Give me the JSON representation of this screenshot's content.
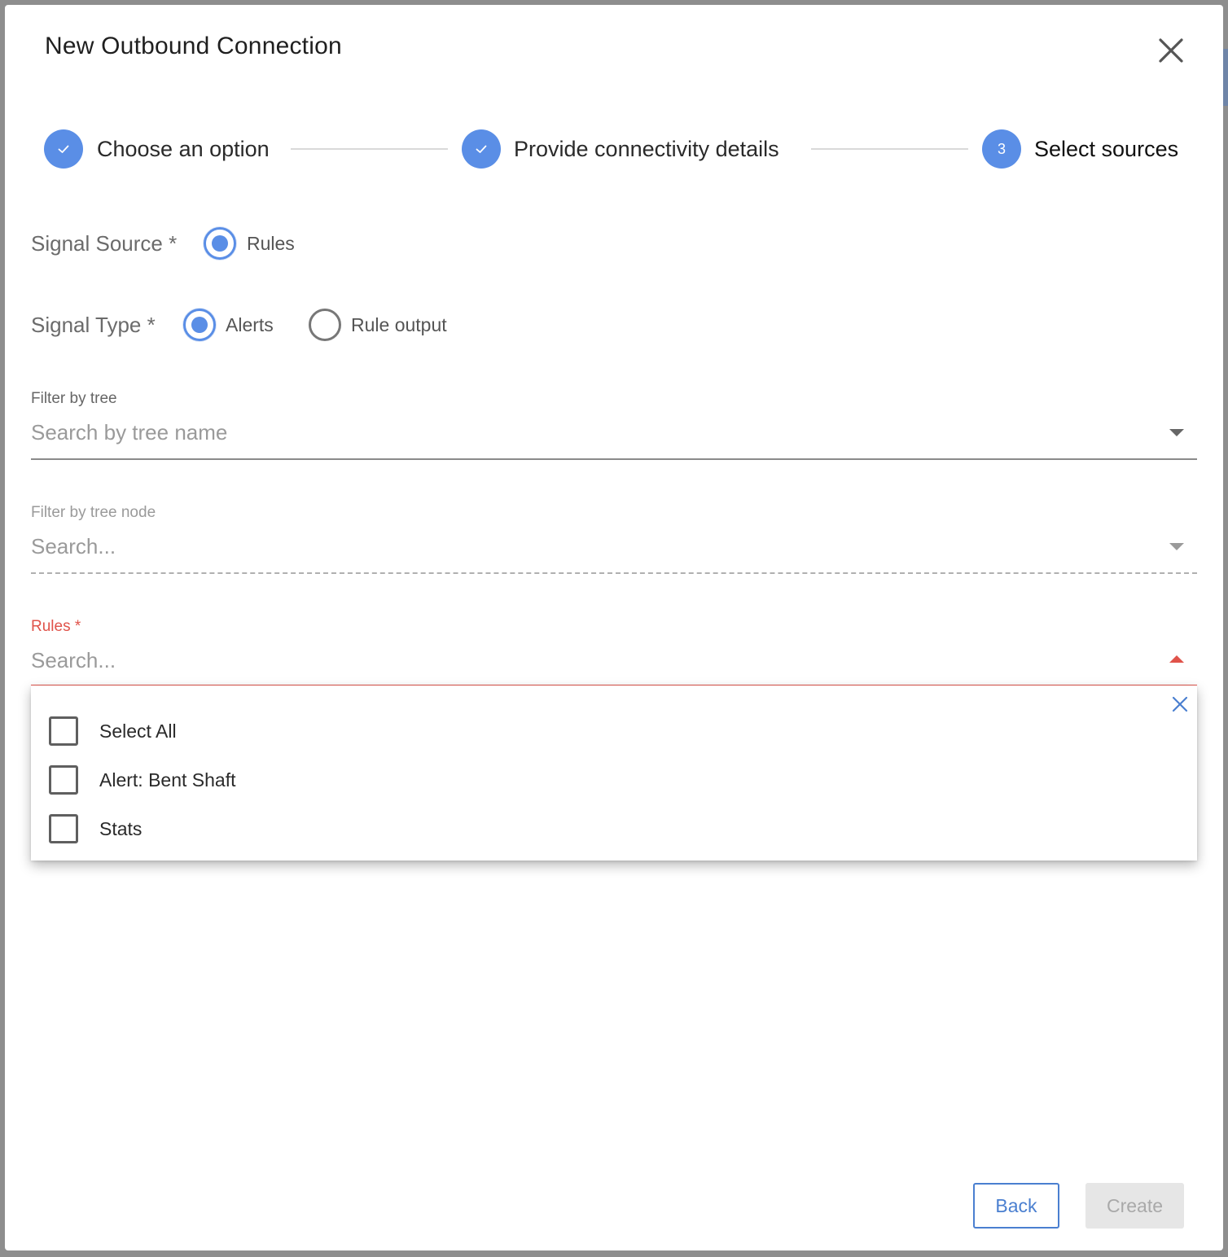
{
  "dialog": {
    "title": "New Outbound Connection",
    "close_icon": "close-icon"
  },
  "stepper": {
    "steps": [
      {
        "label": "Choose an option",
        "state": "completed",
        "icon": "check-icon"
      },
      {
        "label": "Provide connectivity details",
        "state": "completed",
        "icon": "check-icon"
      },
      {
        "label": "Select sources",
        "state": "active",
        "number": "3"
      }
    ]
  },
  "signal_source": {
    "label": "Signal Source *",
    "options": [
      {
        "label": "Rules",
        "checked": true
      }
    ]
  },
  "signal_type": {
    "label": "Signal Type *",
    "options": [
      {
        "label": "Alerts",
        "checked": true
      },
      {
        "label": "Rule output",
        "checked": false
      }
    ]
  },
  "filter_tree": {
    "label": "Filter by tree",
    "placeholder": "Search by tree name"
  },
  "filter_tree_node": {
    "label": "Filter by tree node",
    "placeholder": "Search...",
    "disabled": true
  },
  "rules": {
    "label": "Rules *",
    "placeholder": "Search...",
    "error_color": "#e0534a",
    "open": true,
    "options": [
      {
        "label": "Select All",
        "checked": false
      },
      {
        "label": "Alert: Bent Shaft",
        "checked": false
      },
      {
        "label": "Stats",
        "checked": false
      }
    ]
  },
  "footer": {
    "back_label": "Back",
    "create_label": "Create",
    "create_disabled": true
  },
  "colors": {
    "accent": "#5a8ee6",
    "error": "#e0534a",
    "button_outline": "#4a7fd0"
  }
}
